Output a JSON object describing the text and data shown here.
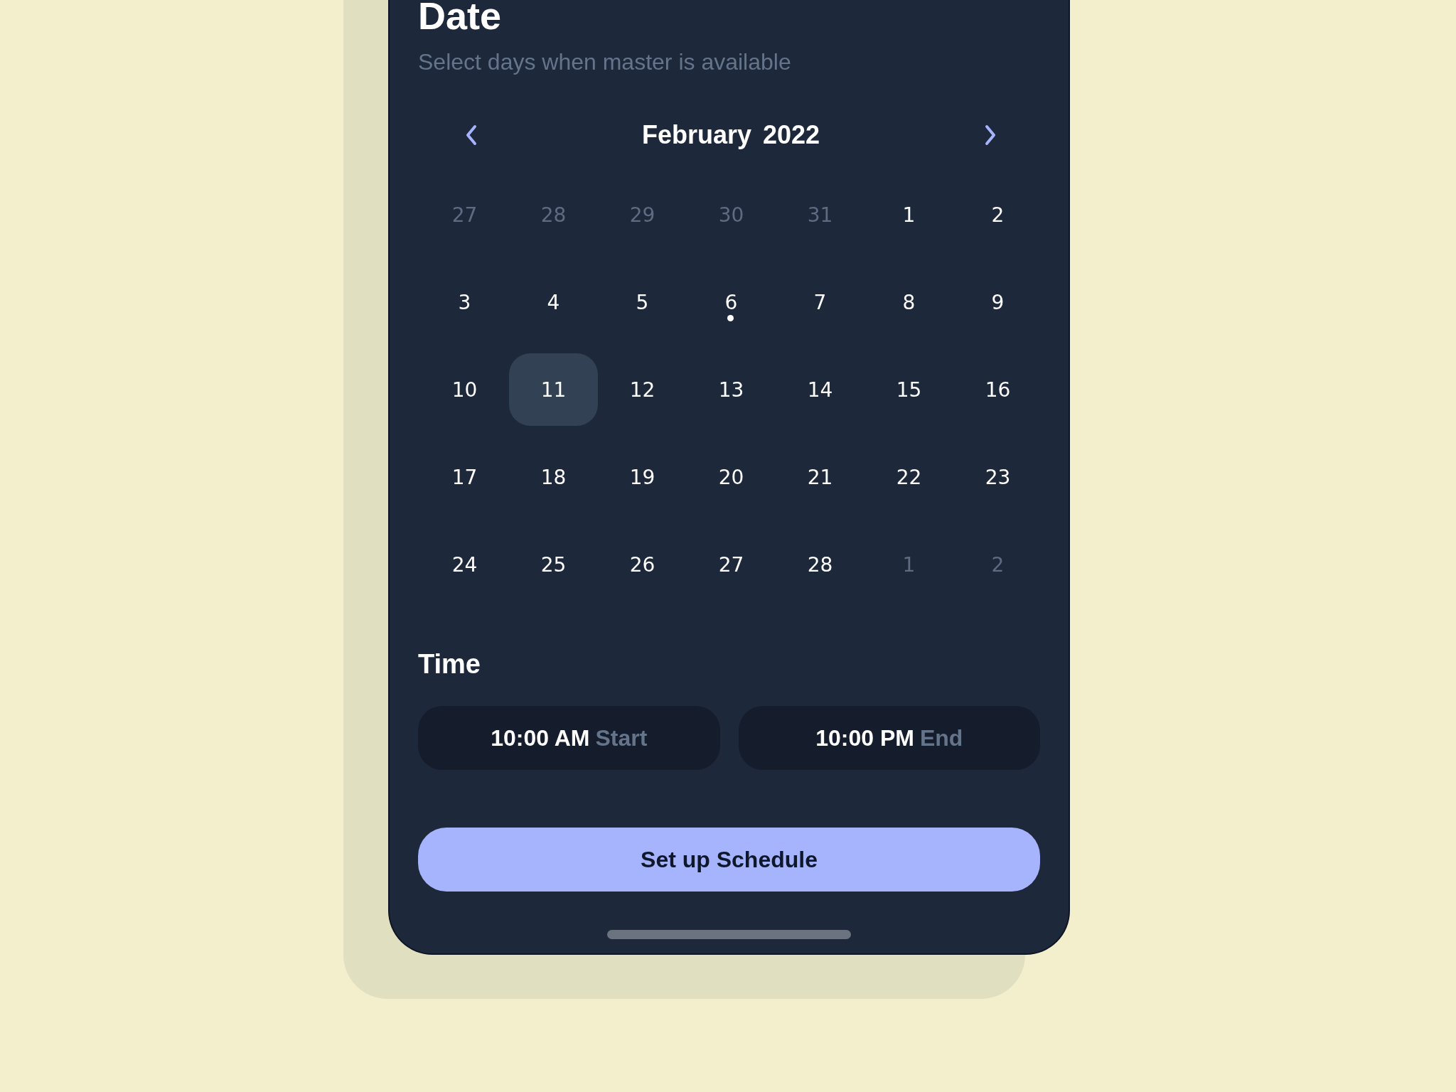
{
  "header": {
    "title": "Date",
    "subtitle": "Select days when master is available"
  },
  "calendar": {
    "month": "February",
    "year": "2022",
    "days": [
      {
        "label": "27",
        "other_month": true,
        "selected": false,
        "has_event": false
      },
      {
        "label": "28",
        "other_month": true,
        "selected": false,
        "has_event": false
      },
      {
        "label": "29",
        "other_month": true,
        "selected": false,
        "has_event": false
      },
      {
        "label": "30",
        "other_month": true,
        "selected": false,
        "has_event": false
      },
      {
        "label": "31",
        "other_month": true,
        "selected": false,
        "has_event": false
      },
      {
        "label": "1",
        "other_month": false,
        "selected": false,
        "has_event": false
      },
      {
        "label": "2",
        "other_month": false,
        "selected": false,
        "has_event": false
      },
      {
        "label": "3",
        "other_month": false,
        "selected": false,
        "has_event": false
      },
      {
        "label": "4",
        "other_month": false,
        "selected": false,
        "has_event": false
      },
      {
        "label": "5",
        "other_month": false,
        "selected": false,
        "has_event": false
      },
      {
        "label": "6",
        "other_month": false,
        "selected": false,
        "has_event": true
      },
      {
        "label": "7",
        "other_month": false,
        "selected": false,
        "has_event": false
      },
      {
        "label": "8",
        "other_month": false,
        "selected": false,
        "has_event": false
      },
      {
        "label": "9",
        "other_month": false,
        "selected": false,
        "has_event": false
      },
      {
        "label": "10",
        "other_month": false,
        "selected": false,
        "has_event": false
      },
      {
        "label": "11",
        "other_month": false,
        "selected": true,
        "has_event": false
      },
      {
        "label": "12",
        "other_month": false,
        "selected": false,
        "has_event": false
      },
      {
        "label": "13",
        "other_month": false,
        "selected": false,
        "has_event": false
      },
      {
        "label": "14",
        "other_month": false,
        "selected": false,
        "has_event": false
      },
      {
        "label": "15",
        "other_month": false,
        "selected": false,
        "has_event": false
      },
      {
        "label": "16",
        "other_month": false,
        "selected": false,
        "has_event": false
      },
      {
        "label": "17",
        "other_month": false,
        "selected": false,
        "has_event": false
      },
      {
        "label": "18",
        "other_month": false,
        "selected": false,
        "has_event": false
      },
      {
        "label": "19",
        "other_month": false,
        "selected": false,
        "has_event": false
      },
      {
        "label": "20",
        "other_month": false,
        "selected": false,
        "has_event": false
      },
      {
        "label": "21",
        "other_month": false,
        "selected": false,
        "has_event": false
      },
      {
        "label": "22",
        "other_month": false,
        "selected": false,
        "has_event": false
      },
      {
        "label": "23",
        "other_month": false,
        "selected": false,
        "has_event": false
      },
      {
        "label": "24",
        "other_month": false,
        "selected": false,
        "has_event": false
      },
      {
        "label": "25",
        "other_month": false,
        "selected": false,
        "has_event": false
      },
      {
        "label": "26",
        "other_month": false,
        "selected": false,
        "has_event": false
      },
      {
        "label": "27",
        "other_month": false,
        "selected": false,
        "has_event": false
      },
      {
        "label": "28",
        "other_month": false,
        "selected": false,
        "has_event": false
      },
      {
        "label": "1",
        "other_month": true,
        "selected": false,
        "has_event": false
      },
      {
        "label": "2",
        "other_month": true,
        "selected": false,
        "has_event": false
      }
    ]
  },
  "time": {
    "title": "Time",
    "fields": [
      {
        "value": "10:00 AM",
        "label": "Start"
      },
      {
        "value": "10:00 PM",
        "label": "End"
      }
    ]
  },
  "button": {
    "label": "Set up Schedule"
  }
}
